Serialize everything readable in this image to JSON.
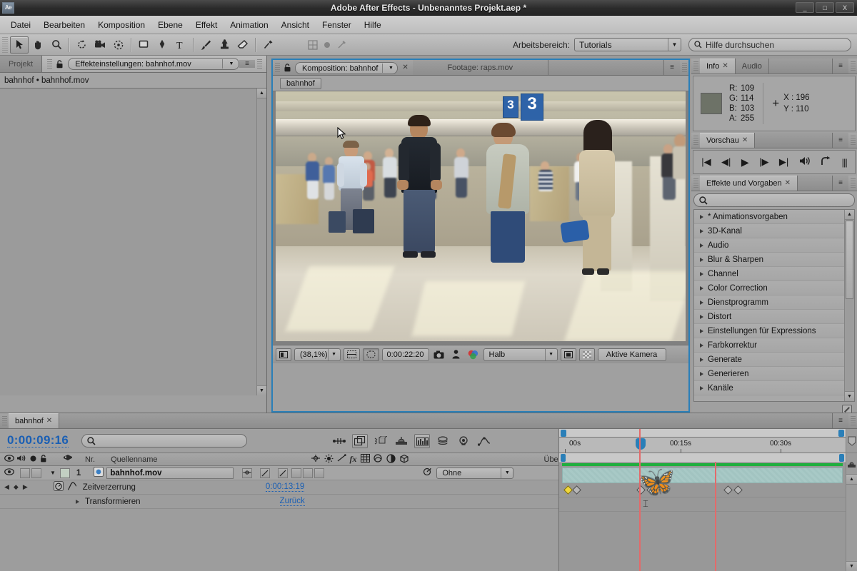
{
  "window": {
    "app_icon": "Ae",
    "title": "Adobe After Effects - Unbenanntes Projekt.aep *",
    "minimize": "_",
    "maximize": "□",
    "close": "X"
  },
  "menubar": {
    "items": [
      {
        "label": "Datei"
      },
      {
        "label": "Bearbeiten"
      },
      {
        "label": "Komposition"
      },
      {
        "label": "Ebene"
      },
      {
        "label": "Effekt"
      },
      {
        "label": "Animation"
      },
      {
        "label": "Ansicht"
      },
      {
        "label": "Fenster"
      },
      {
        "label": "Hilfe"
      }
    ]
  },
  "toolbar": {
    "tools": [
      {
        "name": "selection-tool",
        "icon": "arrow"
      },
      {
        "name": "hand-tool",
        "icon": "hand"
      },
      {
        "name": "zoom-tool",
        "icon": "magnifier"
      },
      {
        "name": "rotation-tool",
        "icon": "rotate"
      },
      {
        "name": "camera-tool",
        "icon": "camera"
      },
      {
        "name": "pan-behind-tool",
        "icon": "anchor"
      },
      {
        "name": "shape-tool",
        "icon": "rect"
      },
      {
        "name": "pen-tool",
        "icon": "pen"
      },
      {
        "name": "text-tool",
        "icon": "type"
      },
      {
        "name": "brush-tool",
        "icon": "brush"
      },
      {
        "name": "clone-stamp-tool",
        "icon": "stamp"
      },
      {
        "name": "eraser-tool",
        "icon": "eraser"
      },
      {
        "name": "puppet-pin-tool",
        "icon": "pin"
      }
    ],
    "workspace_label": "Arbeitsbereich:",
    "workspace_value": "Tutorials",
    "help_placeholder": "Hilfe durchsuchen"
  },
  "left_panel": {
    "tab_project": "Projekt",
    "tab_effect_controls": "Effekteinstellungen: bahnhof.mov",
    "breadcrumb": "bahnhof • bahnhof.mov"
  },
  "comp_panel": {
    "tab_composition": "Komposition: bahnhof",
    "tab_footage": "Footage: raps.mov",
    "breadcrumb_button": "bahnhof",
    "zoom_level": "(38,1%)",
    "current_time": "0:00:22:20",
    "resolution": "Halb",
    "view_camera": "Aktive Kamera",
    "platform_sign": "3"
  },
  "info_panel": {
    "tab_info": "Info",
    "tab_audio": "Audio",
    "color": {
      "r_label": "R:",
      "r_value": "109",
      "g_label": "G:",
      "g_value": "114",
      "b_label": "B:",
      "b_value": "103",
      "a_label": "A:",
      "a_value": "255",
      "swatch_hex": "#6d7267"
    },
    "position": {
      "x_label": "X : 196",
      "y_label": "Y : 110"
    }
  },
  "preview_panel": {
    "tab_label": "Vorschau",
    "buttons": [
      {
        "name": "first-frame-button",
        "glyph": "|◀"
      },
      {
        "name": "previous-frame-button",
        "glyph": "◀|"
      },
      {
        "name": "play-button",
        "glyph": "▶"
      },
      {
        "name": "next-frame-button",
        "glyph": "|▶"
      },
      {
        "name": "last-frame-button",
        "glyph": "▶|"
      },
      {
        "name": "audio-button",
        "glyph": "🔊"
      },
      {
        "name": "loop-button",
        "glyph": "⤴"
      },
      {
        "name": "ram-preview-button",
        "glyph": "|||"
      }
    ]
  },
  "effects_panel": {
    "tab_label": "Effekte und Vorgaben",
    "search_placeholder": "",
    "categories": [
      {
        "label": "* Animationsvorgaben"
      },
      {
        "label": "3D-Kanal"
      },
      {
        "label": "Audio"
      },
      {
        "label": "Blur & Sharpen"
      },
      {
        "label": "Channel"
      },
      {
        "label": "Color Correction"
      },
      {
        "label": "Dienstprogramm"
      },
      {
        "label": "Distort"
      },
      {
        "label": "Einstellungen für Expressions"
      },
      {
        "label": "Farbkorrektur"
      },
      {
        "label": "Generate"
      },
      {
        "label": "Generieren"
      },
      {
        "label": "Kanäle"
      }
    ]
  },
  "timeline": {
    "tab_label": "bahnhof",
    "current_time": "0:00:09:16",
    "search_placeholder": "",
    "columns": {
      "number": "Nr.",
      "source_name": "Quellenname",
      "parent": "Übergeordnet"
    },
    "layers": [
      {
        "number": "1",
        "name": "bahnhof.mov",
        "parent_value": "Ohne"
      }
    ],
    "properties": [
      {
        "label": "Zeitverzerrung",
        "value": "0:00:13:19",
        "is_link": true
      },
      {
        "label": "Transformieren",
        "value": "Zurück",
        "is_link": true
      }
    ],
    "ruler_ticks": [
      {
        "label": "00s",
        "pos_pct": 1
      },
      {
        "label": "00:15s",
        "pos_pct": 42
      },
      {
        "label": "00:30s",
        "pos_pct": 83
      }
    ],
    "keyframes_row1": [
      2,
      31,
      58
    ],
    "keyframes_row1_gold": 2,
    "playhead_pct": 29
  },
  "colors": {
    "accent_blue": "#2a7fb8",
    "link_blue": "#1a5fb4",
    "panel_bg": "#9d9d9d",
    "green_bar": "#1faf3e",
    "playhead_red": "#e36a6a"
  }
}
